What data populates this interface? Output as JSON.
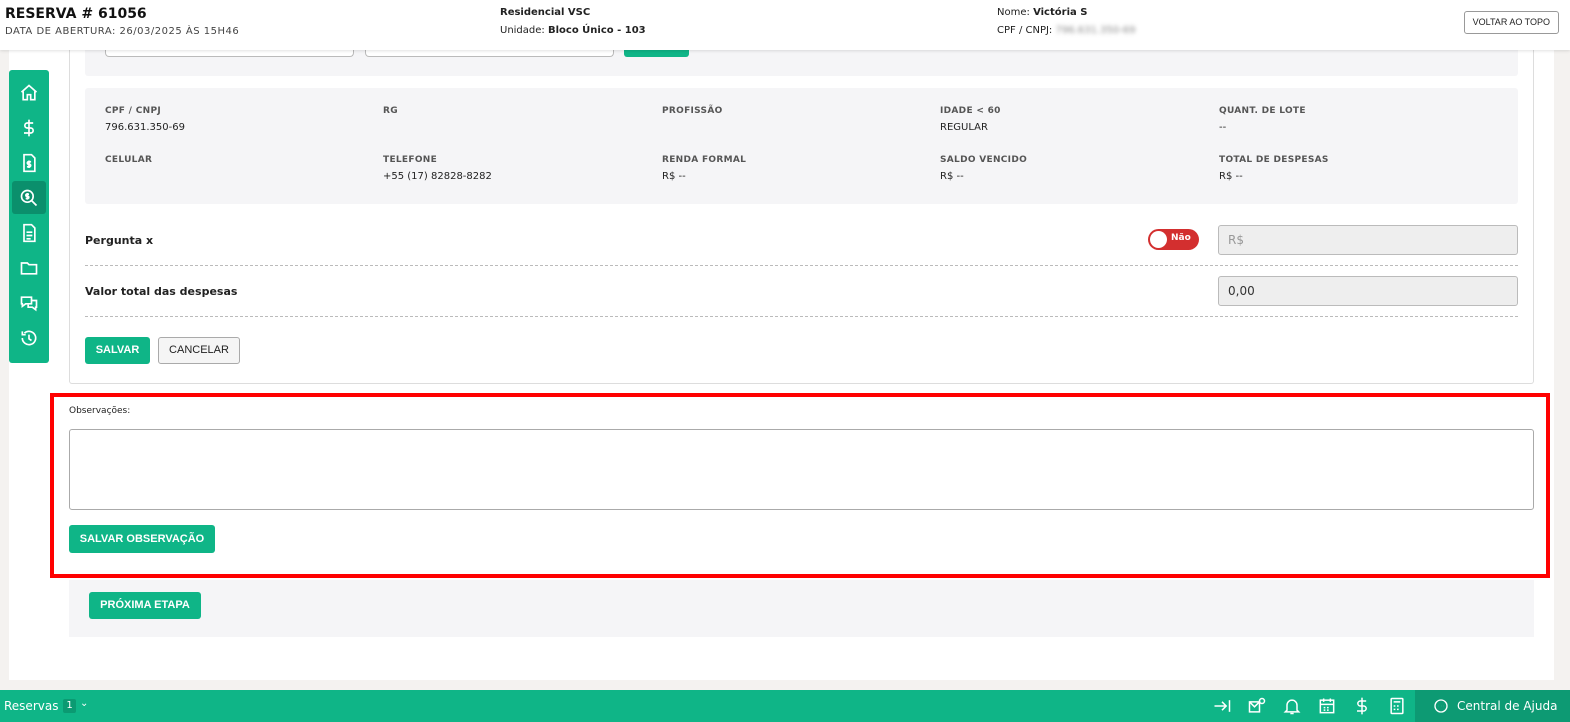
{
  "header": {
    "title": "RESERVA # 61056",
    "opening_date": "DATA DE ABERTURA: 26/03/2025 ÀS 15H46",
    "project": "Residencial VSC",
    "unit_label": "Unidade:",
    "unit_value": "Bloco Único - 103",
    "name_label": "Nome:",
    "name_value": "Victória S",
    "cpf_label": "CPF / CNPJ:",
    "cpf_value": "796.631.350-69",
    "back_to_top": "VOLTAR AO TOPO"
  },
  "sidebar": {
    "items": [
      {
        "icon": "home-icon"
      },
      {
        "icon": "dollar-icon"
      },
      {
        "icon": "document-dollar-icon"
      },
      {
        "icon": "search-dollar-icon",
        "active": true
      },
      {
        "icon": "file-icon"
      },
      {
        "icon": "folder-icon"
      },
      {
        "icon": "chat-icon"
      },
      {
        "icon": "history-icon"
      }
    ]
  },
  "details": {
    "cpf_cnpj": {
      "label": "CPF / CNPJ",
      "value": "796.631.350-69"
    },
    "rg": {
      "label": "RG",
      "value": ""
    },
    "profissao": {
      "label": "PROFISSÃO",
      "value": ""
    },
    "idade": {
      "label": "IDADE < 60",
      "value": "REGULAR"
    },
    "lote": {
      "label": "QUANT. DE LOTE",
      "value": "--"
    },
    "celular": {
      "label": "CELULAR",
      "value": ""
    },
    "telefone": {
      "label": "TELEFONE",
      "value": "+55 (17) 82828-8282"
    },
    "renda": {
      "label": "RENDA FORMAL",
      "value": "R$ --"
    },
    "saldo": {
      "label": "SALDO VENCIDO",
      "value": "R$ --"
    },
    "despesas": {
      "label": "TOTAL DE DESPESAS",
      "value": "R$ --"
    }
  },
  "form": {
    "question_label": "Pergunta x",
    "toggle_label": "Não",
    "question_placeholder": "R$",
    "total_label": "Valor total das despesas",
    "total_value": "0,00",
    "save": "SALVAR",
    "cancel": "CANCELAR"
  },
  "observations": {
    "label": "Observações:",
    "value": "",
    "save": "SALVAR OBSERVAÇÃO"
  },
  "next_step": "PRÓXIMA ETAPA",
  "bottom_bar": {
    "reservations": "Reservas",
    "count": "1",
    "help": "Central de Ajuda"
  },
  "colors": {
    "brand": "#0fb587",
    "danger": "#d32f2f",
    "highlight": "#ff0000"
  }
}
